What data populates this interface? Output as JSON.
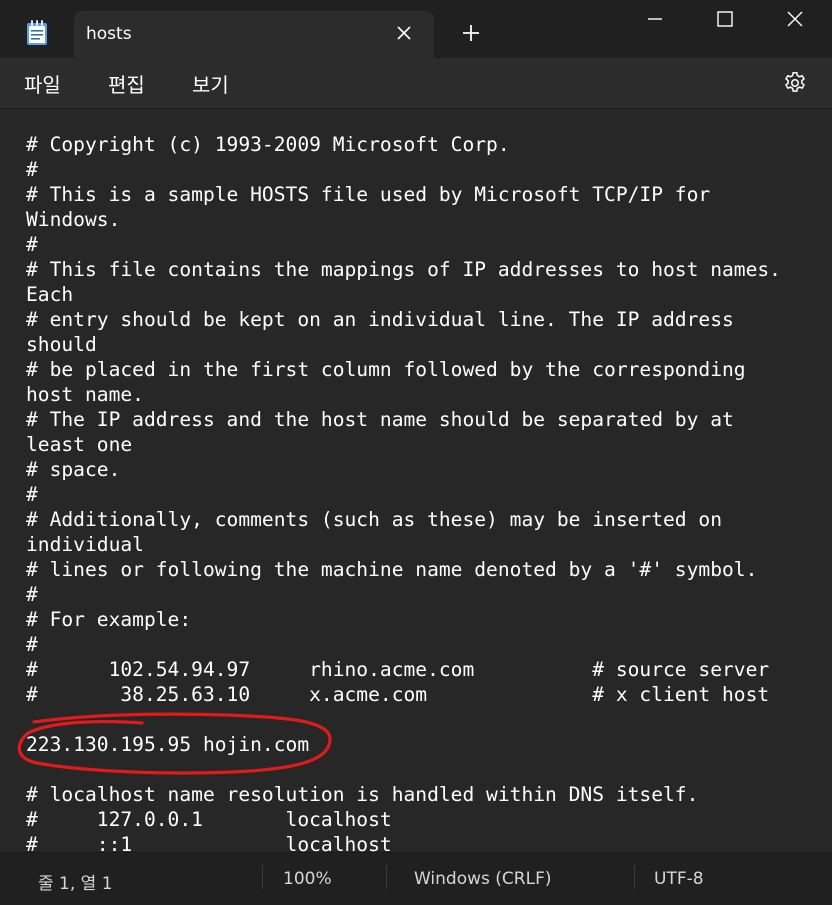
{
  "tab": {
    "title": "hosts",
    "close_icon": "close-icon"
  },
  "title_bar": {
    "new_tab_icon": "plus-icon"
  },
  "window_controls": [
    "minimize-icon",
    "maximize-icon",
    "close-icon"
  ],
  "menu": {
    "items": [
      {
        "label": "파일"
      },
      {
        "label": "편집"
      },
      {
        "label": "보기"
      }
    ],
    "settings_icon": "gear-icon"
  },
  "editor": {
    "lines": [
      "# Copyright (c) 1993-2009 Microsoft Corp.",
      "#",
      "# This is a sample HOSTS file used by Microsoft TCP/IP for",
      "Windows.",
      "#",
      "# This file contains the mappings of IP addresses to host names.",
      "Each",
      "# entry should be kept on an individual line. The IP address",
      "should",
      "# be placed in the first column followed by the corresponding",
      "host name.",
      "# The IP address and the host name should be separated by at",
      "least one",
      "# space.",
      "#",
      "# Additionally, comments (such as these) may be inserted on",
      "individual",
      "# lines or following the machine name denoted by a '#' symbol.",
      "#",
      "# For example:",
      "#",
      "#      102.54.94.97     rhino.acme.com          # source server",
      "#       38.25.63.10     x.acme.com              # x client host",
      "",
      "223.130.195.95 hojin.com",
      "",
      "# localhost name resolution is handled within DNS itself.",
      "#     127.0.0.1       localhost",
      "#     ::1             localhost"
    ],
    "annotation_color": "#e01b1b"
  },
  "status": {
    "position": "줄 1, 열 1",
    "zoom": "100%",
    "line_ending": "Windows (CRLF)",
    "encoding": "UTF-8"
  },
  "colors": {
    "background": "#202020",
    "editor_bg": "#272727",
    "text": "#ffffff"
  }
}
